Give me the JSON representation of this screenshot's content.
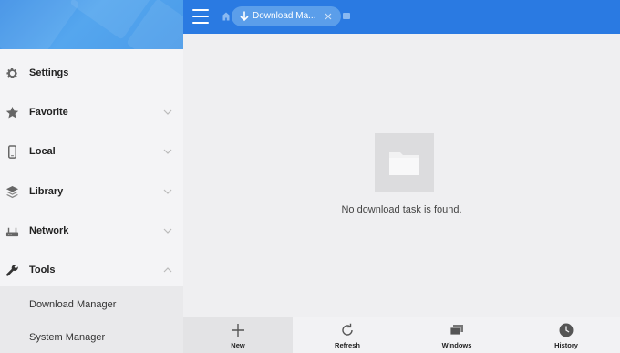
{
  "theme": {
    "accent": "#2a7ae2",
    "chip": "#5b9eea",
    "sidebar_bg": "#f4f4f6",
    "content_bg": "#efeff1"
  },
  "sidebar": {
    "items": [
      {
        "label": "Settings",
        "icon": "gear-icon",
        "expandable": false
      },
      {
        "label": "Favorite",
        "icon": "star-icon",
        "expandable": true,
        "expanded": false
      },
      {
        "label": "Local",
        "icon": "phone-icon",
        "expandable": true,
        "expanded": false
      },
      {
        "label": "Library",
        "icon": "layers-icon",
        "expandable": true,
        "expanded": false
      },
      {
        "label": "Network",
        "icon": "network-icon",
        "expandable": true,
        "expanded": false
      },
      {
        "label": "Tools",
        "icon": "wrench-icon",
        "expandable": true,
        "expanded": true
      }
    ],
    "sub_items": [
      {
        "label": "Download Manager"
      },
      {
        "label": "System Manager"
      }
    ]
  },
  "topbar": {
    "menu_icon": "hamburger-icon",
    "home_icon": "home-icon",
    "tab": {
      "label": "Download Ma...",
      "icon": "download-icon",
      "close_icon": "close-icon"
    },
    "new_tab_icon": "new-tab-icon"
  },
  "content": {
    "empty_icon": "folder-icon",
    "empty_message": "No download task is found."
  },
  "bottombar": {
    "items": [
      {
        "label": "New",
        "icon": "plus-icon",
        "active": true
      },
      {
        "label": "Refresh",
        "icon": "refresh-icon",
        "active": false
      },
      {
        "label": "Windows",
        "icon": "windows-icon",
        "active": false
      },
      {
        "label": "History",
        "icon": "clock-icon",
        "active": false
      }
    ]
  }
}
